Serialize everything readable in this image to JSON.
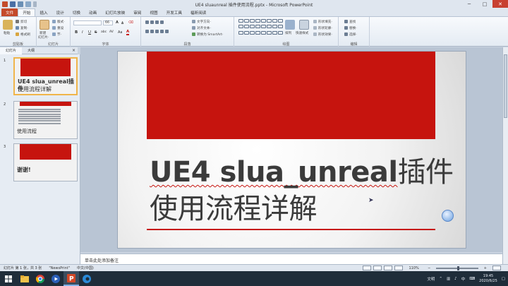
{
  "window": {
    "title": "UE4 sluaunreal 插件使用流程.pptx - Microsoft PowerPoint",
    "controls": {
      "minimize": "─",
      "maximize": "□",
      "close": "✕"
    }
  },
  "ribbon_tabs": [
    "文件",
    "开始",
    "插入",
    "设计",
    "切换",
    "动画",
    "幻灯片放映",
    "审阅",
    "视图",
    "开发工具",
    "福昕阅读"
  ],
  "ribbon": {
    "clipboard": {
      "label": "剪贴板",
      "paste": "粘贴",
      "cut": "剪切",
      "copy": "复制·",
      "format_painter": "格式刷"
    },
    "slides": {
      "label": "幻灯片",
      "new_slide": "新建",
      "new_slide2": "幻灯片·",
      "layout": "版式·",
      "reset": "重设",
      "section": "节·"
    },
    "font": {
      "label": "字体",
      "font_size": "66",
      "bold": "B",
      "italic": "I",
      "underline": "U",
      "strike": "S",
      "shadow": "abc",
      "spacing": "AV",
      "case": "Aa",
      "color": "A"
    },
    "paragraph": {
      "label": "段落",
      "text_direction": "文字方向·",
      "align_text": "对齐文本·",
      "smartart": "转换为 SmartArt·"
    },
    "drawing": {
      "label": "绘图",
      "arrange": "排列",
      "quick_styles": "快速样式",
      "shape_fill": "形状填充·",
      "shape_outline": "形状轮廓·",
      "shape_effects": "形状效果·"
    },
    "editing": {
      "label": "编辑",
      "find": "查找",
      "replace": "替换·",
      "select": "选择·"
    }
  },
  "panel_tabs": {
    "slides": "幻灯片",
    "outline": "大纲",
    "close": "×"
  },
  "thumbnails": [
    {
      "num": "1",
      "title_line1": "UE4 slua_unreal插件",
      "title_line2": "使用流程详解"
    },
    {
      "num": "2",
      "title": "使用流程"
    },
    {
      "num": "3",
      "title": "谢谢!"
    }
  ],
  "slide": {
    "title_en": "UE4 slua_unreal",
    "title_cn1": "插件",
    "title_line2": "使用流程详解"
  },
  "notes": {
    "placeholder": "单击此处添加备注"
  },
  "status": {
    "slide_pos": "幻灯片 第 1 张，共 3 张",
    "theme": "\"NewsPrint\"",
    "language": "中文(中国)",
    "zoom": "110%",
    "zoom_out": "─",
    "zoom_in": "+"
  },
  "taskbar": {
    "ime": "中",
    "time": "19:45",
    "date": "2020/6/25",
    "tray_text": "文明",
    "notif": "▢"
  },
  "colors": {
    "accent_red": "#c6140e",
    "selected_thumb": "#f0b54a",
    "file_tab": "#c44a2a"
  }
}
